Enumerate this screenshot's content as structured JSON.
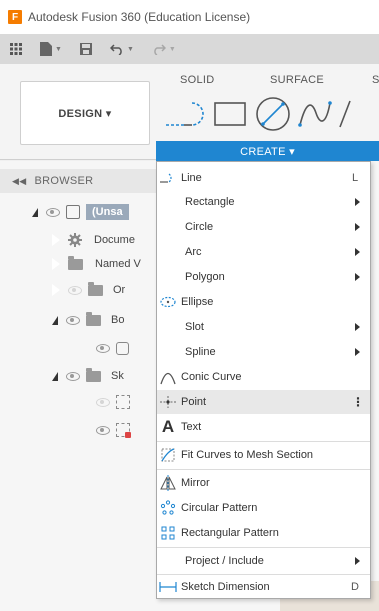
{
  "window": {
    "title": "Autodesk Fusion 360 (Education License)",
    "logo_letter": "F"
  },
  "ribbon": {
    "workspace_label": "DESIGN ▾",
    "tabs": [
      "SOLID",
      "SURFACE",
      "S"
    ],
    "create_label": "CREATE ▾"
  },
  "browser": {
    "header": "BROWSER",
    "rows": [
      {
        "label": "(Unsa"
      },
      {
        "label": "Docume"
      },
      {
        "label": "Named V"
      },
      {
        "label": "Or"
      },
      {
        "label": "Bo"
      },
      {
        "label": ""
      },
      {
        "label": "Sk"
      }
    ]
  },
  "menu": {
    "items": [
      {
        "label": "Line",
        "shortcut": "L",
        "icon": "line-icon"
      },
      {
        "label": "Rectangle",
        "submenu": true
      },
      {
        "label": "Circle",
        "submenu": true
      },
      {
        "label": "Arc",
        "submenu": true
      },
      {
        "label": "Polygon",
        "submenu": true
      },
      {
        "label": "Ellipse",
        "icon": "ellipse-icon"
      },
      {
        "label": "Slot",
        "submenu": true
      },
      {
        "label": "Spline",
        "submenu": true
      },
      {
        "label": "Conic Curve",
        "icon": "conic-curve-icon"
      },
      {
        "label": "Point",
        "icon": "point-icon",
        "highlighted": true
      },
      {
        "label": "Text",
        "icon": "text-icon"
      },
      {
        "label": "Fit Curves to Mesh Section",
        "icon": "fit-curves-icon"
      },
      {
        "label": "Mirror",
        "icon": "mirror-icon"
      },
      {
        "label": "Circular Pattern",
        "icon": "circular-pattern-icon"
      },
      {
        "label": "Rectangular Pattern",
        "icon": "rectangular-pattern-icon"
      },
      {
        "label": "Project / Include",
        "submenu": true
      },
      {
        "label": "Sketch Dimension",
        "shortcut": "D",
        "icon": "sketch-dimension-icon"
      }
    ]
  },
  "colors": {
    "accent": "#1f86d1",
    "logo": "#f57c00"
  }
}
